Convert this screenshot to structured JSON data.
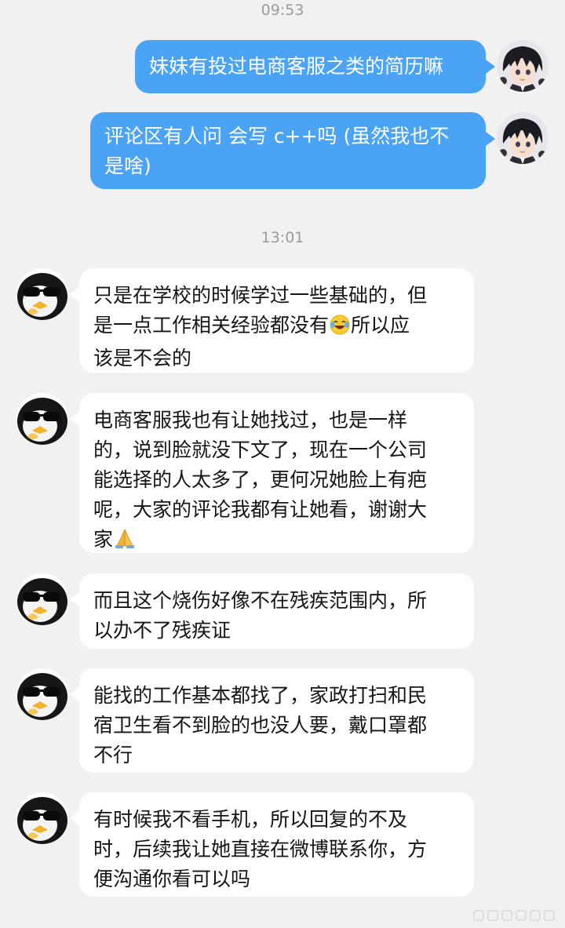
{
  "chat": {
    "timestamps": [
      "09:53",
      "13:01"
    ],
    "messages": [
      {
        "sender": "self",
        "lines": [
          "妹妹有投过电商客服之类的简历嘛"
        ]
      },
      {
        "sender": "self",
        "lines": [
          "评论区有人问 会写 c++吗 (虽然我也不",
          "是啥)"
        ]
      },
      {
        "sender": "other",
        "lines": [
          "只是在学校的时候学过一些基础的，但",
          "是一点工作相关经验都没有",
          "所以应",
          "该是不会的"
        ],
        "emoji": "laughing-crying-emoji"
      },
      {
        "sender": "other",
        "lines": [
          "电商客服我也有让她找过，也是一样",
          "的，说到脸就没下文了，现在一个公司",
          "能选择的人太多了，更何况她脸上有疤",
          "呢，大家的评论我都有让她看，谢谢大",
          "家"
        ],
        "emoji": "folded-hands-emoji"
      },
      {
        "sender": "other",
        "lines": [
          "而且这个烧伤好像不在残疾范围内，所",
          "以办不了残疾证"
        ]
      },
      {
        "sender": "other",
        "lines": [
          "能找的工作基本都找了，家政打扫和民",
          "宿卫生看不到脸的也没人要，戴口罩都",
          "不行"
        ]
      },
      {
        "sender": "other",
        "lines": [
          "有时候我不看手机，所以回复的不及",
          "时，后续我让她直接在微博联系你，方",
          "便沟通你看可以吗"
        ]
      }
    ]
  },
  "colors": {
    "background": "#f1f1f2",
    "outgoing_bubble": "#4aa3f4",
    "incoming_bubble": "#ffffff",
    "timestamp_text": "#9a9a9a"
  },
  "icons": {
    "self_avatar": "anime-character-avatar",
    "other_avatar": "penguin-sunglasses-avatar"
  }
}
